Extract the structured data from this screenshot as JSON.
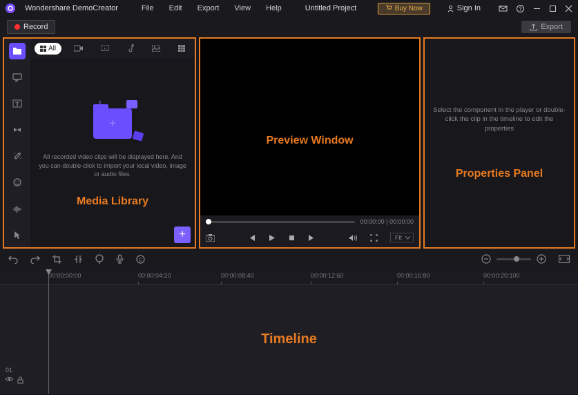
{
  "titlebar": {
    "app_name": "Wondershare DemoCreator",
    "menu": [
      "File",
      "Edit",
      "Export",
      "View",
      "Help"
    ],
    "project": "Untitled Project",
    "buynow": "Buy Now",
    "signin": "Sign In"
  },
  "toolbar": {
    "record": "Record",
    "export": "Export"
  },
  "media": {
    "tab_all": "All",
    "help_text": "All recorded video clips will be displayed here. And you can double-click to import your local video, image or audio files.",
    "label": "Media Library"
  },
  "preview": {
    "label": "Preview Window",
    "time_current": "00:00:00",
    "time_total": "00:00:00",
    "fit": "Fit"
  },
  "properties": {
    "help_text": "Select the component in the player or double-click the clip in the timeline to edit the properties",
    "label": "Properties Panel"
  },
  "timeline": {
    "label": "Timeline",
    "ticks": [
      "00:00:00:00",
      "00:00:04:20",
      "00:00:08:40",
      "00:00:12:60",
      "00:00:16:80",
      "00:00:20:100"
    ],
    "track_num": "01"
  }
}
